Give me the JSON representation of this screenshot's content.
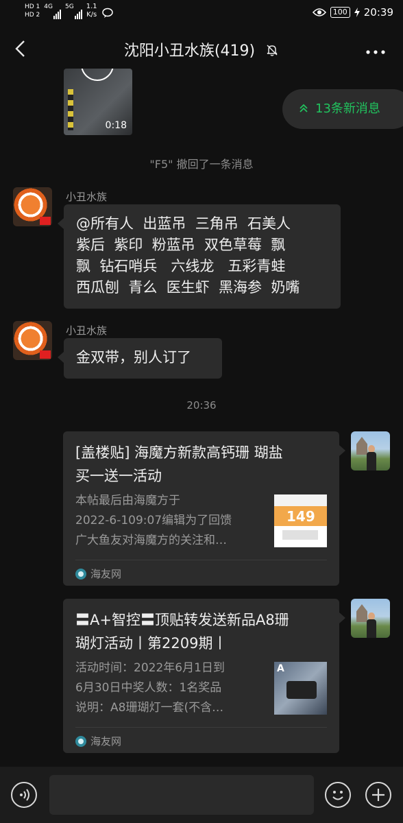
{
  "status_bar": {
    "hd1": "HD 1",
    "hd2": "HD 2",
    "net1": "4G",
    "net2": "5G",
    "speed": "1.1",
    "speed_unit": "K/s",
    "battery": "100",
    "time": "20:39"
  },
  "header": {
    "title": "沈阳小丑水族(419)"
  },
  "video": {
    "duration": "0:18"
  },
  "new_messages_pill": "13条新消息",
  "system_message": "\"F5\" 撤回了一条消息",
  "messages": [
    {
      "sender": "小丑水族",
      "lines": [
        "@所有人  出蓝吊  三角吊  石美人",
        "紫后  紫印  粉蓝吊  双色草莓  飘",
        "飘  钻石哨兵   六线龙   五彩青蛙",
        "西瓜刨  青么  医生虾  黑海参  奶嘴"
      ]
    },
    {
      "sender": "小丑水族",
      "lines": [
        "金双带，别人订了"
      ]
    }
  ],
  "timestamp": "20:36",
  "cards": [
    {
      "title_lines": [
        "[盖楼贴] 海魔方新款高钙珊 瑚盐",
        "买一送一活动"
      ],
      "desc_lines": [
        "本帖最后由海魔方于",
        "2022-6-109:07编辑为了回馈",
        "广大鱼友对海魔方的关注和…"
      ],
      "thumb_text": "149",
      "source": "海友网"
    },
    {
      "title_lines": [
        "〓A+智控〓顶贴转发送新品A8珊",
        "瑚灯活动丨第2209期丨"
      ],
      "desc_lines": [
        "活动时间：2022年6月1日到",
        "6月30日中奖人数：1名奖品",
        "说明：A8珊瑚灯一套(不含…"
      ],
      "thumb_text": "A",
      "source": "海友网"
    }
  ],
  "colors": {
    "background": "#111111",
    "bubble": "#2c2c2c",
    "accent_green": "#21c35e"
  }
}
